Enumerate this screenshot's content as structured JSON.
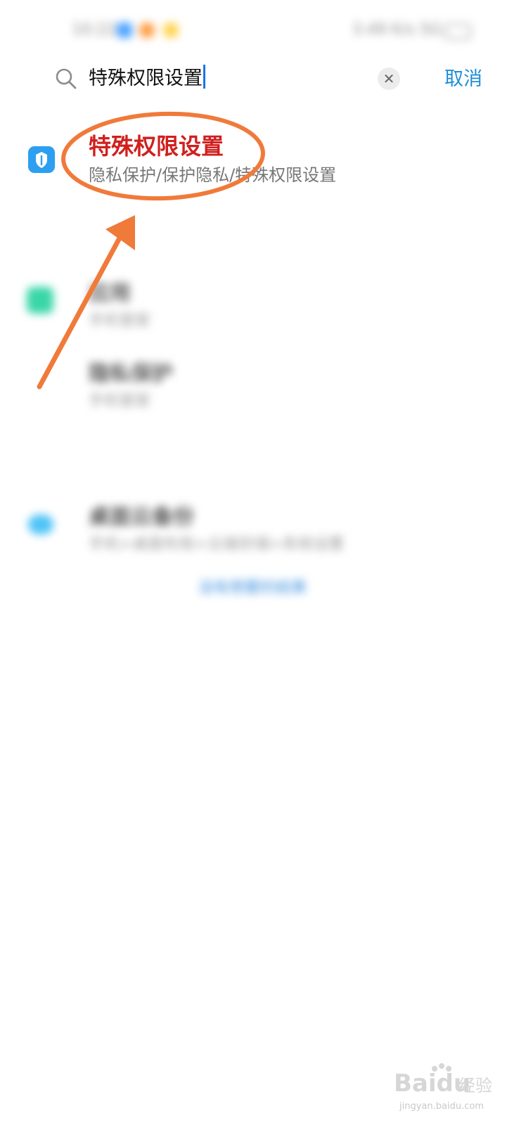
{
  "status_bar": {
    "time": "10:22",
    "right_text": "3.49 K/s 5G",
    "accent_colors": [
      "#4da3ff",
      "#ff9a3c",
      "#ffd24a"
    ]
  },
  "search": {
    "query": "特殊权限设置",
    "cancel_label": "取消",
    "clear_icon": "close-icon",
    "search_icon": "search-icon"
  },
  "results": [
    {
      "title": "特殊权限设置",
      "subtitle": "隐私保护/保护隐私/特殊权限设置",
      "icon": "privacy-shield-icon",
      "icon_color": "#2c9ff0",
      "highlight_color": "#d0201e"
    }
  ],
  "blurred_results": [
    {
      "title": "应用",
      "subtitle": "手机管家",
      "icon_color": "#3ad6a8"
    },
    {
      "title": "隐私保护",
      "subtitle": "手机管家"
    },
    {
      "title": "桌面云备份",
      "subtitle": "手机>桌面布局>云端存储>系统设置",
      "icon_color": "#4fc3f7"
    }
  ],
  "more_link": "没有想要的结果",
  "annotation": {
    "ellipse_color": "#f07a3a",
    "arrow_color": "#f07a3a"
  },
  "watermark": {
    "brand": "Baidu",
    "cn": "经验",
    "url": "jingyan.baidu.com"
  }
}
